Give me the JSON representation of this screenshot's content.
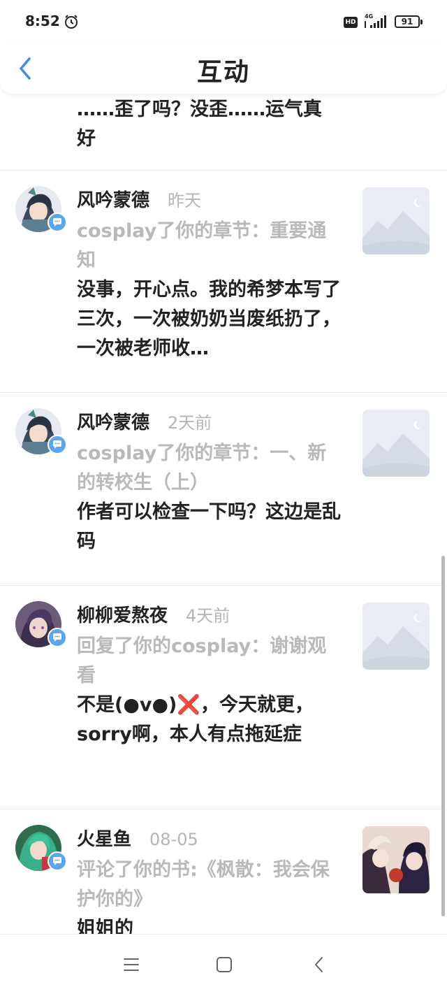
{
  "status_bar": {
    "time": "8:52",
    "hd_label": "HD",
    "network": "4G",
    "battery": "91"
  },
  "header": {
    "title": "互动"
  },
  "feed": {
    "partial_item": {
      "text": "……歪了吗？没歪……运气真好"
    },
    "items": [
      {
        "name": "风吟蒙德",
        "time": "昨天",
        "action": "cosplay了你的章节：重要通知",
        "comment": "没事，开心点。我的希梦本写了三次，一次被奶奶当废纸扔了，一次被老师收…",
        "avatar_icon": "anime-avatar-icon",
        "thumb_icon": "placeholder-image-icon"
      },
      {
        "name": "风吟蒙德",
        "time": "2天前",
        "action": "cosplay了你的章节：一、新的转校生（上）",
        "comment": "作者可以检查一下吗？这边是乱码",
        "avatar_icon": "anime-avatar-icon",
        "thumb_icon": "placeholder-image-icon"
      },
      {
        "name": "柳柳爱熬夜",
        "time": "4天前",
        "action": "回复了你的cosplay：谢谢观看",
        "comment": "不是(●v●)❌，今天就更，sorry啊，本人有点拖延症",
        "avatar_icon": "anime-avatar-icon",
        "thumb_icon": "placeholder-image-icon"
      },
      {
        "name": "火星鱼",
        "time": "08-05",
        "action": "评论了你的书:《枫散：我会保护你的》",
        "comment": "姐姐的",
        "avatar_icon": "anime-avatar-icon",
        "thumb_icon": "book-cover-icon"
      }
    ]
  },
  "colors": {
    "accent_blue": "#3a8ee6",
    "badge_blue": "#5aa6f0",
    "muted_text": "#b9b9b9"
  }
}
